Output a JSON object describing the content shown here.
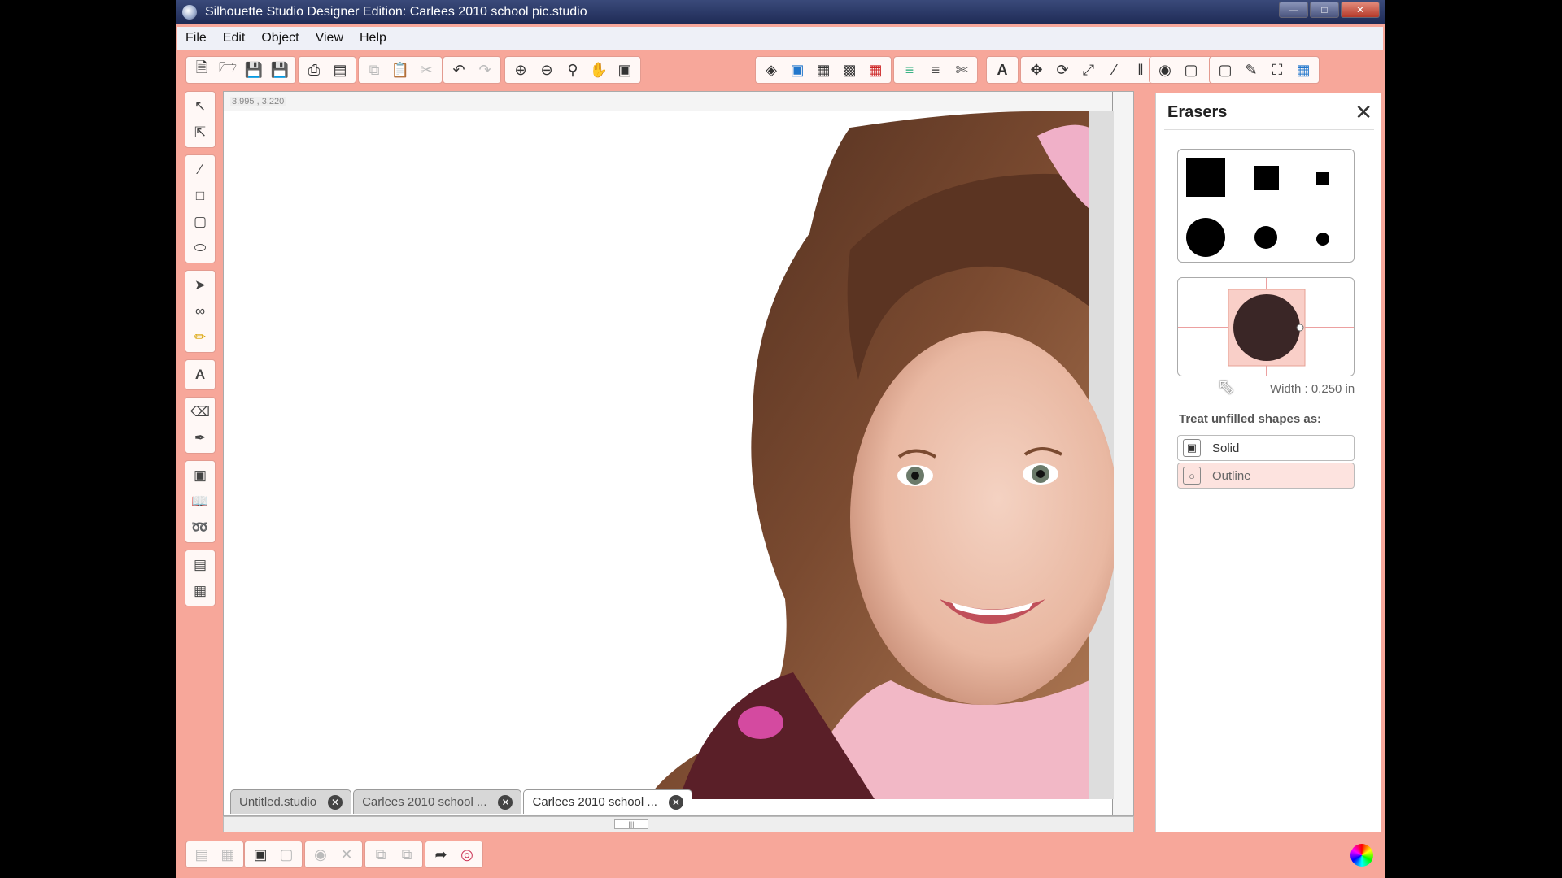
{
  "window": {
    "title": "Silhouette Studio Designer Edition: Carlees 2010 school pic.studio"
  },
  "menu": [
    "File",
    "Edit",
    "Object",
    "View",
    "Help"
  ],
  "ruler": {
    "coord": "3.995 , 3.220"
  },
  "tabs": [
    {
      "label": "Untitled.studio",
      "active": false
    },
    {
      "label": "Carlees 2010 school ...",
      "active": false
    },
    {
      "label": "Carlees 2010 school ...",
      "active": true
    }
  ],
  "panel": {
    "title": "Erasers",
    "width_label": "Width : 0.250 in",
    "treat_label": "Treat unfilled shapes as:",
    "options": [
      {
        "label": "Solid",
        "selected": false
      },
      {
        "label": "Outline",
        "selected": true
      }
    ]
  },
  "colors": {
    "accent": "#f7a79a",
    "titlebar": "#1e2a55",
    "eraser_preview": "#3a2626"
  }
}
